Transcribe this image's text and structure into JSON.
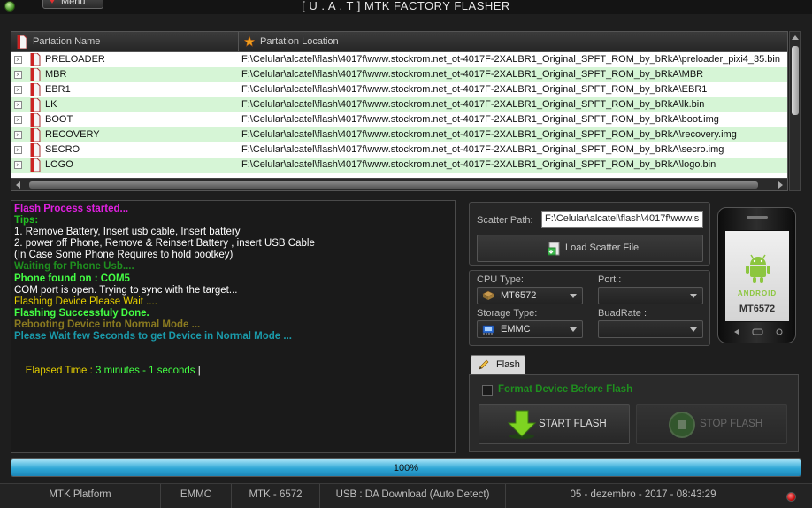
{
  "window": {
    "title": "[ U . A . T ] MTK FACTORY FLASHER",
    "menu_label": "Menu"
  },
  "partition_table": {
    "columns": [
      "Partation Name",
      "Partation Location"
    ],
    "rows": [
      {
        "name": "PRELOADER",
        "location": "F:\\Celular\\alcatel\\flash\\4017f\\www.stockrom.net_ot-4017F-2XALBR1_Original_SPFT_ROM_by_bRkA\\preloader_pixi4_35.bin"
      },
      {
        "name": "MBR",
        "location": "F:\\Celular\\alcatel\\flash\\4017f\\www.stockrom.net_ot-4017F-2XALBR1_Original_SPFT_ROM_by_bRkA\\MBR"
      },
      {
        "name": "EBR1",
        "location": "F:\\Celular\\alcatel\\flash\\4017f\\www.stockrom.net_ot-4017F-2XALBR1_Original_SPFT_ROM_by_bRkA\\EBR1"
      },
      {
        "name": "LK",
        "location": "F:\\Celular\\alcatel\\flash\\4017f\\www.stockrom.net_ot-4017F-2XALBR1_Original_SPFT_ROM_by_bRkA\\lk.bin"
      },
      {
        "name": "BOOT",
        "location": "F:\\Celular\\alcatel\\flash\\4017f\\www.stockrom.net_ot-4017F-2XALBR1_Original_SPFT_ROM_by_bRkA\\boot.img"
      },
      {
        "name": "RECOVERY",
        "location": "F:\\Celular\\alcatel\\flash\\4017f\\www.stockrom.net_ot-4017F-2XALBR1_Original_SPFT_ROM_by_bRkA\\recovery.img"
      },
      {
        "name": "SECRO",
        "location": "F:\\Celular\\alcatel\\flash\\4017f\\www.stockrom.net_ot-4017F-2XALBR1_Original_SPFT_ROM_by_bRkA\\secro.img"
      },
      {
        "name": "LOGO",
        "location": "F:\\Celular\\alcatel\\flash\\4017f\\www.stockrom.net_ot-4017F-2XALBR1_Original_SPFT_ROM_by_bRkA\\logo.bin"
      }
    ]
  },
  "log": {
    "lines": [
      {
        "text": "Flash Process started...",
        "color": "#e020e0",
        "bold": true
      },
      {
        "text": "Tips:",
        "color": "#22c022",
        "bold": true
      },
      {
        "text": "1. Remove Battery, Insert usb cable, Insert battery",
        "color": "#ffffff",
        "bold": false
      },
      {
        "text": "2. power off Phone, Remove & Reinsert Battery , insert USB Cable",
        "color": "#ffffff",
        "bold": false
      },
      {
        "text": "(In Case Some Phone Requires to hold bootkey)",
        "color": "#ffffff",
        "bold": false
      },
      {
        "text": "Waiting for Phone Usb....",
        "color": "#1f8f1f",
        "bold": true
      },
      {
        "text": "Phone found on : COM5",
        "color": "#44ff44",
        "bold": true
      },
      {
        "text": "COM port is open. Trying to sync with the target...",
        "color": "#ffffff",
        "bold": false
      },
      {
        "text": "Flashing Device Please Wait ....",
        "color": "#e6d000",
        "bold": false
      },
      {
        "text": "Flashing Successfuly Done.",
        "color": "#44ff44",
        "bold": true
      },
      {
        "text": "Rebooting Device into Normal Mode ...",
        "color": "#8a7a20",
        "bold": true
      },
      {
        "text": "Please Wait few Seconds to get Device in Normal Mode ...",
        "color": "#1a9aaa",
        "bold": true
      }
    ],
    "elapsed_label": "Elapsed Time : ",
    "elapsed_value": "3 minutes - 1 seconds",
    "elapsed_label_color": "#e6d000",
    "elapsed_value_color": "#44ff44"
  },
  "scatter": {
    "label": "Scatter Path:",
    "path_value": "F:\\Celular\\alcatel\\flash\\4017f\\www.s",
    "load_button": "Load Scatter File"
  },
  "device": {
    "cpu_label": "CPU Type:",
    "cpu_value": "MT6572",
    "port_label": "Port :",
    "port_value": "",
    "storage_label": "Storage Type:",
    "storage_value": "EMMC",
    "baud_label": "BuadRate :",
    "baud_value": ""
  },
  "phone_image": {
    "brand_text": "ANDROID",
    "model_text": "MT6572"
  },
  "flash_tab": {
    "tab_label": "Flash",
    "format_option": "Format Device Before Flash",
    "format_checked": false,
    "start_button": "START FLASH",
    "stop_button": "STOP FLASH"
  },
  "progress": {
    "percent_label": "100%",
    "fraction": 1.0
  },
  "statusbar": {
    "platform": "MTK Platform",
    "storage": "EMMC",
    "chip": "MTK - 6572",
    "usb_mode": "USB : DA Download (Auto Detect)",
    "datetime": "05 - dezembro - 2017  -  08:43:29"
  },
  "icons": {
    "title_orb": "app-orb-icon",
    "menu": "heart-icon",
    "file": "file-icon",
    "location": "star-pin-icon",
    "load": "load-file-icon",
    "cpu": "chip-icon",
    "storage": "memory-card-icon",
    "flash_tab": "pencil-icon",
    "start": "download-arrow-icon",
    "stop": "stop-icon",
    "record": "record-icon"
  }
}
